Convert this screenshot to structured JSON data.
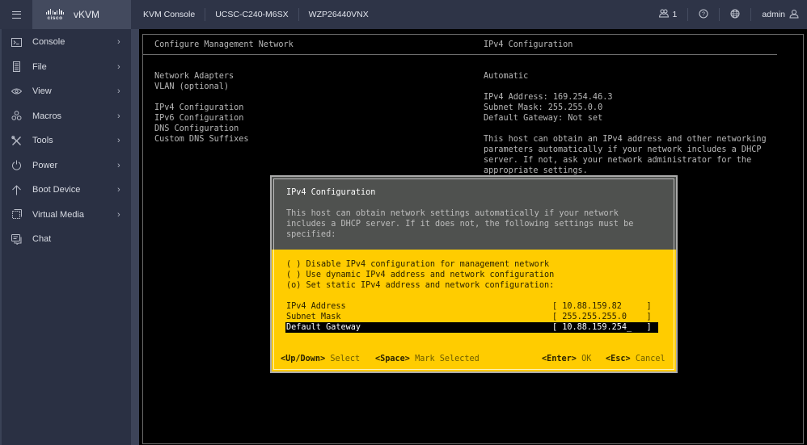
{
  "header": {
    "brand_logo_text": "cisco",
    "app_name": "vKVM",
    "breadcrumbs": [
      "KVM Console",
      "UCSC-C240-M6SX",
      "WZP26440VNX"
    ],
    "users_count": "1",
    "user": "admin",
    "icons": {
      "menu": "hamburger-icon",
      "users": "users-icon",
      "help": "help-icon",
      "language": "globe-icon",
      "user": "user-icon"
    }
  },
  "sidebar": {
    "items": [
      {
        "label": "Console",
        "icon": "console-icon",
        "chevron": "›"
      },
      {
        "label": "File",
        "icon": "file-icon",
        "chevron": "›"
      },
      {
        "label": "View",
        "icon": "eye-icon",
        "chevron": "›"
      },
      {
        "label": "Macros",
        "icon": "macros-icon",
        "chevron": "›"
      },
      {
        "label": "Tools",
        "icon": "tools-icon",
        "chevron": "›"
      },
      {
        "label": "Power",
        "icon": "power-icon",
        "chevron": "›"
      },
      {
        "label": "Boot Device",
        "icon": "arrow-up-icon",
        "chevron": "›"
      },
      {
        "label": "Virtual Media",
        "icon": "virtual-media-icon",
        "chevron": "›"
      },
      {
        "label": "Chat",
        "icon": "chat-icon",
        "chevron": ""
      }
    ]
  },
  "console": {
    "left_title": "Configure Management Network",
    "menu": [
      "Network Adapters",
      "VLAN (optional)",
      "",
      "IPv4 Configuration",
      "IPv6 Configuration",
      "DNS Configuration",
      "Custom DNS Suffixes"
    ],
    "right_title": "IPv4 Configuration",
    "right_mode": "Automatic",
    "right_details": [
      "IPv4 Address: 169.254.46.3",
      "Subnet Mask: 255.255.0.0",
      "Default Gateway: Not set"
    ],
    "right_help": [
      "This host can obtain an IPv4 address and other networking",
      "parameters automatically if your network includes a DHCP",
      "server. If not, ask your network administrator for the",
      "appropriate settings."
    ]
  },
  "dialog": {
    "title": "IPv4 Configuration",
    "description": [
      "This host can obtain network settings automatically if your network",
      "includes a DHCP server. If it does not, the following settings must be",
      "specified:"
    ],
    "options": [
      {
        "marker": "( )",
        "label": "Disable IPv4 configuration for management network",
        "selected": false
      },
      {
        "marker": "( )",
        "label": "Use dynamic IPv4 address and network configuration",
        "selected": false
      },
      {
        "marker": "(o)",
        "label": "Set static IPv4 address and network configuration:",
        "selected": true
      }
    ],
    "fields": [
      {
        "label": "IPv4 Address",
        "value": "[ 10.88.159.82     ]"
      },
      {
        "label": "Subnet Mask",
        "value": "[ 255.255.255.0    ]"
      },
      {
        "label": "Default Gateway",
        "value": "[ 10.88.159.254_   ]"
      }
    ],
    "footer": [
      {
        "key": "<Up/Down>",
        "action": "Select"
      },
      {
        "key": "<Space>",
        "action": "Mark Selected"
      },
      {
        "key": "<Enter>",
        "action": "OK"
      },
      {
        "key": "<Esc>",
        "action": "Cancel"
      }
    ]
  }
}
